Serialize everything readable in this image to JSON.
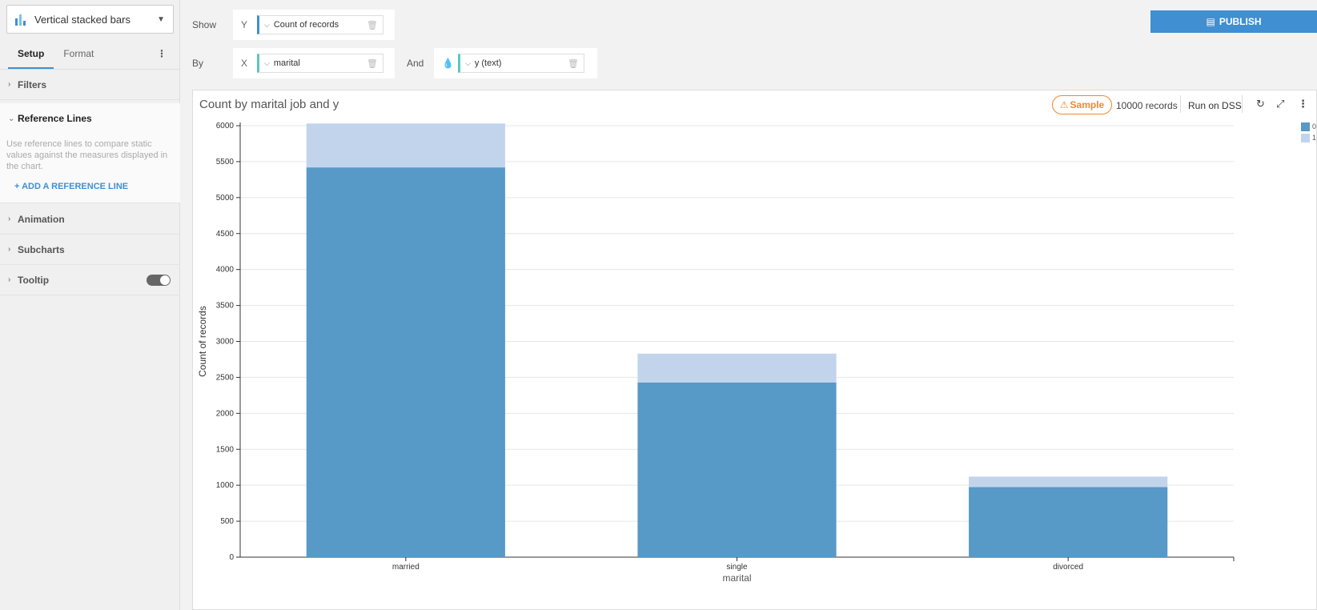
{
  "sidebar": {
    "chart_type": "Vertical stacked bars",
    "tabs": [
      "Setup",
      "Format"
    ],
    "sections": {
      "filters": "Filters",
      "reference_lines": "Reference Lines",
      "reference_desc": "Use reference lines to compare static values against the measures displayed in the chart.",
      "add_reference": "+ ADD A REFERENCE LINE",
      "animation": "Animation",
      "subcharts": "Subcharts",
      "tooltip": "Tooltip"
    }
  },
  "shelves": {
    "show_label": "Show",
    "by_label": "By",
    "and_label": "And",
    "y_key": "Y",
    "x_key": "X",
    "y_value": "Count of records",
    "x_value": "marital",
    "color_value": "y (text)"
  },
  "toolbar": {
    "publish": "PUBLISH"
  },
  "chart_header": {
    "sample": "Sample",
    "records": "10000 records",
    "run_on_dss": "Run on DSS"
  },
  "colors": {
    "series_0": "#5799c7",
    "series_1": "#c2d4ec",
    "accent": "#3f8fd2",
    "sample": "#f0882d"
  },
  "chart_data": {
    "type": "bar",
    "stacked": true,
    "title": "Count by marital job and y",
    "xlabel": "marital",
    "ylabel": "Count of records",
    "categories": [
      "married",
      "single",
      "divorced"
    ],
    "series": [
      {
        "name": "0",
        "values": [
          5420,
          2430,
          975
        ]
      },
      {
        "name": "1",
        "values": [
          610,
          400,
          145
        ]
      }
    ],
    "ylim": [
      0,
      6000
    ],
    "yticks": [
      0,
      500,
      1000,
      1500,
      2000,
      2500,
      3000,
      3500,
      4000,
      4500,
      5000,
      5500,
      6000
    ],
    "grid": true,
    "legend": "top-right"
  }
}
